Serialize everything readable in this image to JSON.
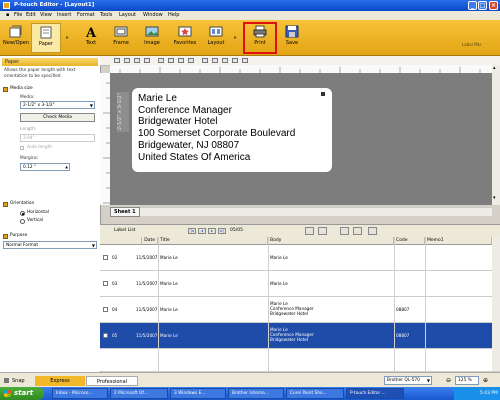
{
  "window": {
    "title": "P-touch Editor - [Layout1]"
  },
  "menu": [
    "File",
    "Edit",
    "View",
    "Insert",
    "Format",
    "Tools",
    "Layout",
    "Window",
    "Help"
  ],
  "toolbar": {
    "buttons": [
      {
        "label": "New/Open",
        "icon": "new-open-icon"
      },
      {
        "label": "Paper",
        "icon": "paper-icon"
      },
      {
        "label": "Text",
        "icon": "text-icon"
      },
      {
        "label": "Frame",
        "icon": "frame-icon"
      },
      {
        "label": "Image",
        "icon": "image-icon"
      },
      {
        "label": "Favorites",
        "icon": "favorites-icon"
      },
      {
        "label": "Layout",
        "icon": "layout-icon"
      },
      {
        "label": "Print",
        "icon": "print-icon"
      },
      {
        "label": "Save",
        "icon": "save-icon"
      }
    ],
    "brand": "Label Mkr",
    "accent": "#f2b82a",
    "highlight": "#e01010"
  },
  "panel": {
    "title": "Paper",
    "description": [
      "Allows the paper length with text",
      "orientation to be specified."
    ],
    "media_size_heading": "Media size",
    "media_label": "Media:",
    "media_value": "2-1/2\" x 3-1/2\"",
    "check_media": "Check Media",
    "length_label": "Length:",
    "length_value": "3.94\"",
    "auto_length": "Auto length",
    "margins_label": "Margins:",
    "margins_value": "0.12 \"",
    "orientation_heading": "Orientation",
    "orient_horizontal": "Horizontal",
    "orient_vertical": "Vertical",
    "purpose_heading": "Purpose",
    "purpose_value": "Normal Format"
  },
  "label": {
    "lines": [
      "Marie Le",
      "Conference Manager",
      "Bridgewater Hotel",
      "100 Somerset Corporate Boulevard",
      "Bridgewater, NJ 08807",
      "United States Of America"
    ],
    "size_tag": "2-1/2\" x 3-1/2\""
  },
  "sheet_tab": "Sheet 1",
  "database": {
    "label_list": "Label List",
    "record_counter": "05/05",
    "columns": [
      "Date",
      "Title",
      "Body",
      "Code",
      "Memo1"
    ],
    "rows": [
      {
        "num": "02",
        "date": "11/5/2007",
        "title": "Marie Le",
        "body": [
          "Marie Le"
        ],
        "code": ""
      },
      {
        "num": "03",
        "date": "11/5/2007",
        "title": "Marie Le",
        "body": [
          "Marie Le"
        ],
        "code": ""
      },
      {
        "num": "04",
        "date": "11/5/2007",
        "title": "Marie Le",
        "body": [
          "Marie Le",
          "Conference Manager",
          "Bridgewater Hotel"
        ],
        "code": "08807"
      },
      {
        "num": "05",
        "date": "11/5/2007",
        "title": "Marie Le",
        "body": [
          "Marie Le",
          "Conference Manager",
          "Bridgewater Hotel"
        ],
        "code": "08807",
        "selected": true
      }
    ]
  },
  "status": {
    "snap": "Snap",
    "express": "Express",
    "professional": "Professional",
    "printer": "Brother QL-570",
    "zoom": "125 %"
  },
  "taskbar": {
    "start": "start",
    "tasks": [
      "Inbox - Microso...",
      "2 Microsoft Of...",
      "3 Windows E...",
      "Brother Interna...",
      "Corel Paint Sho...",
      "P-touch Editor ..."
    ],
    "clock": "5:43 PM"
  }
}
